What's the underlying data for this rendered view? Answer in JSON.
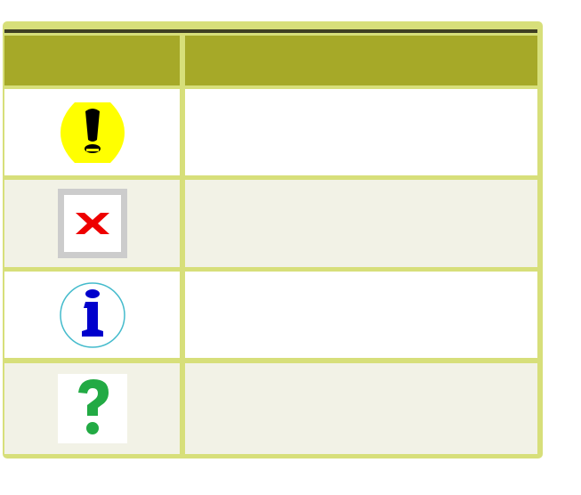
{
  "table": {
    "header": [
      "",
      ""
    ],
    "rows": [
      {
        "icon": "warning-icon",
        "text": ""
      },
      {
        "icon": "error-icon",
        "text": ""
      },
      {
        "icon": "info-icon",
        "text": ""
      },
      {
        "icon": "question-icon",
        "text": ""
      }
    ]
  },
  "colors": {
    "frame": "#d7df7a",
    "header": "#a6a928",
    "rule": "#3f3f22",
    "row_white": "#ffffff",
    "row_cream": "#f2f2e6",
    "warning": "#ffff00",
    "error": "#e00000",
    "info": "#0000cc",
    "question": "#22aa44"
  }
}
